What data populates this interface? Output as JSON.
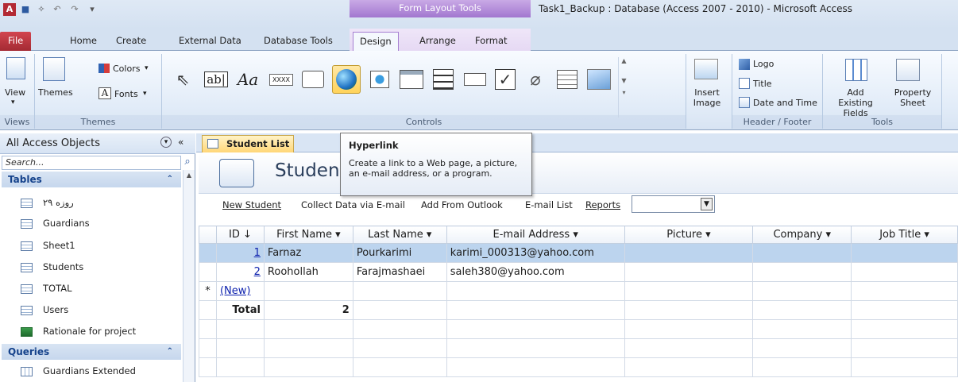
{
  "window": {
    "title": "Task1_Backup : Database (Access 2007 - 2010)  -  Microsoft Access",
    "context_band": "Form Layout Tools",
    "app_icon": "A"
  },
  "tabs": [
    "File",
    "Home",
    "Create",
    "External Data",
    "Database Tools",
    "Design",
    "Arrange",
    "Format"
  ],
  "ribbon": {
    "views": {
      "view_label": "View",
      "group": "Views"
    },
    "themes": {
      "themes_label": "Themes",
      "colors_label": "Colors",
      "fonts_label": "Fonts",
      "group": "Themes"
    },
    "controls": {
      "group": "Controls",
      "insert_image_label": "Insert Image",
      "textbox_glyph": "ab|",
      "label_glyph": "Aa",
      "button_glyph": "XXXX"
    },
    "header_footer": {
      "logo": "Logo",
      "title": "Title",
      "date_time": "Date and Time",
      "group": "Header / Footer"
    },
    "tools": {
      "add_fields": "Add Existing Fields",
      "property_sheet": "Property Sheet",
      "group": "Tools"
    }
  },
  "nav": {
    "header": "All Access Objects",
    "search_placeholder": "Search...",
    "sections": [
      {
        "label": "Tables",
        "items": [
          "۲۹ روزه",
          "Guardians",
          "Sheet1",
          "Students",
          "TOTAL",
          "Users",
          "Rationale for project"
        ]
      },
      {
        "label": "Queries",
        "items": [
          "Guardians Extended"
        ]
      }
    ]
  },
  "document": {
    "tab_label": "Student List",
    "form_title": "Student List",
    "links": [
      "New Student",
      "Collect Data via E-mail",
      "Add From Outlook",
      "E-mail List",
      "Reports"
    ]
  },
  "tooltip": {
    "title": "Hyperlink",
    "description": "Create a link to a Web page, a picture, an e-mail address, or a program."
  },
  "grid": {
    "columns": [
      "ID",
      "First Name",
      "Last Name",
      "E-mail Address",
      "Picture",
      "Company",
      "Job Title"
    ],
    "rows": [
      {
        "id": "1",
        "first": "Farnaz",
        "last": "Pourkarimi",
        "email": "karimi_000313@yahoo.com"
      },
      {
        "id": "2",
        "first": "Roohollah",
        "last": "Farajmashaei",
        "email": "saleh380@yahoo.com"
      }
    ],
    "new_row_label": "(New)",
    "new_row_marker": "*",
    "total_label": "Total",
    "total_value": "2"
  },
  "colors": {
    "accent_purple": "#a277cf",
    "file_red": "#c0363f",
    "selection": "#ffd35a"
  }
}
